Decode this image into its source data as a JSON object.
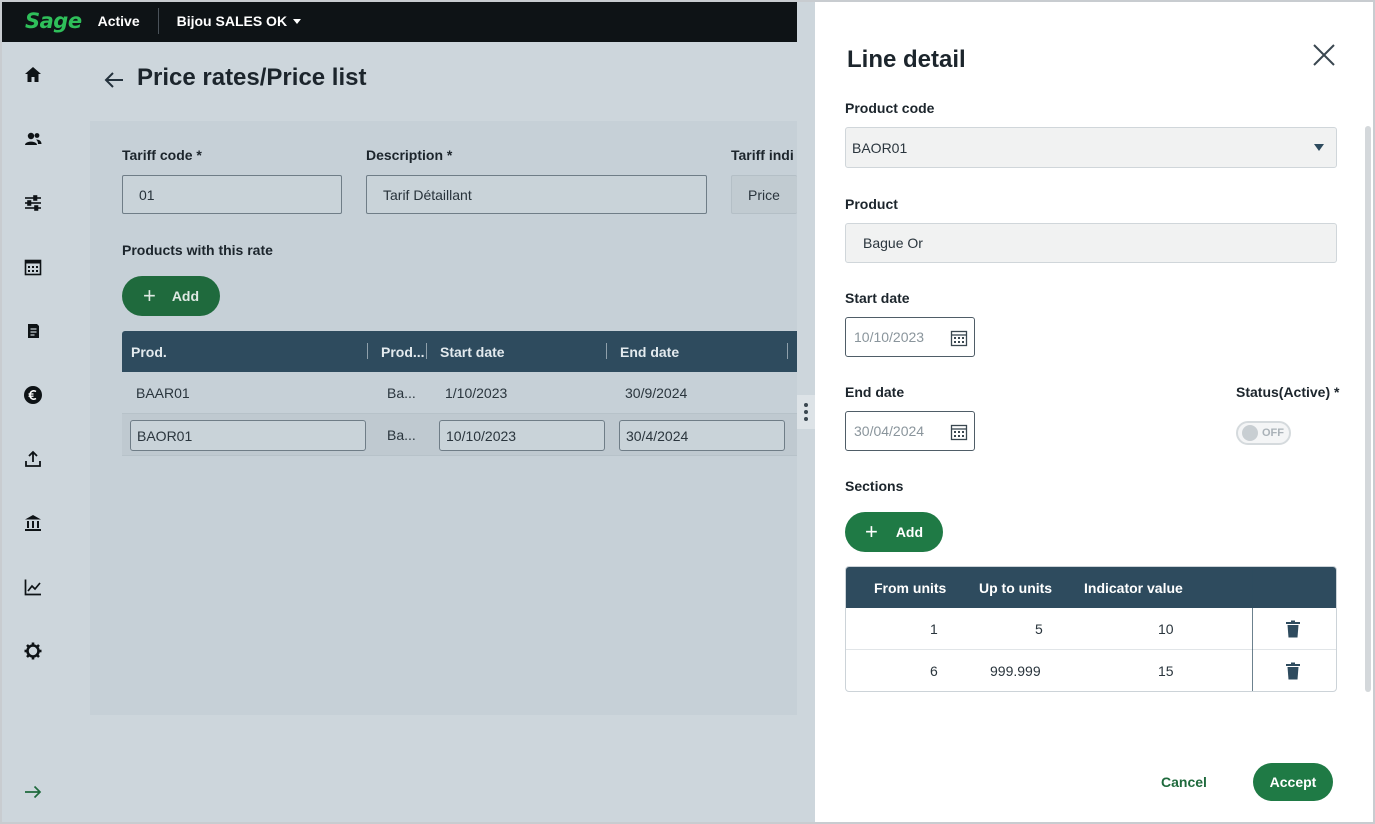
{
  "topbar": {
    "brand": "Sage",
    "status": "Active",
    "company": "Bijou SALES OK"
  },
  "sidebar": {
    "items": [
      {
        "icon": "home-icon"
      },
      {
        "icon": "contacts-icon"
      },
      {
        "icon": "settings-sliders-icon"
      },
      {
        "icon": "calendar-icon"
      },
      {
        "icon": "document-icon"
      },
      {
        "icon": "euro-icon"
      },
      {
        "icon": "upload-icon"
      },
      {
        "icon": "bank-icon"
      },
      {
        "icon": "chart-icon"
      },
      {
        "icon": "gear-icon"
      }
    ],
    "expand_icon": "arrow-right-icon"
  },
  "main": {
    "title": "Price rates/Price list",
    "fields": {
      "tariff_code_label": "Tariff code *",
      "tariff_code_value": "01",
      "description_label": "Description *",
      "description_value": "Tarif Détaillant",
      "tariff_indicator_label": "Tariff indi",
      "tariff_indicator_value": "Price"
    },
    "products_label": "Products with this rate",
    "add_label": "Add",
    "grid": {
      "columns": [
        "Prod.",
        "Prod...",
        "Start date",
        "End date"
      ],
      "rows": [
        {
          "code": "BAAR01",
          "product": "Ba...",
          "start": "1/10/2023",
          "end": "30/9/2024"
        },
        {
          "code": "BAOR01",
          "product": "Ba...",
          "start": "10/10/2023",
          "end": "30/4/2024"
        }
      ]
    }
  },
  "panel": {
    "title": "Line detail",
    "product_code_label": "Product code",
    "product_code_value": "BAOR01",
    "product_label": "Product",
    "product_value": "Bague Or",
    "start_date_label": "Start date",
    "start_date_value": "10/10/2023",
    "end_date_label": "End date",
    "end_date_value": "30/04/2024",
    "status_label": "Status(Active) *",
    "status_toggle": "OFF",
    "sections_label": "Sections",
    "add_label": "Add",
    "sections": {
      "columns": [
        "From units",
        "Up to units",
        "Indicator value"
      ],
      "rows": [
        {
          "from": "1",
          "to": "5",
          "value": "10"
        },
        {
          "from": "6",
          "to": "999.999",
          "value": "15"
        }
      ]
    },
    "cancel_label": "Cancel",
    "accept_label": "Accept"
  },
  "colors": {
    "primary_green": "#1f7a45",
    "grid_header": "#2e4b5e",
    "brand_green": "#2fbf5a"
  }
}
